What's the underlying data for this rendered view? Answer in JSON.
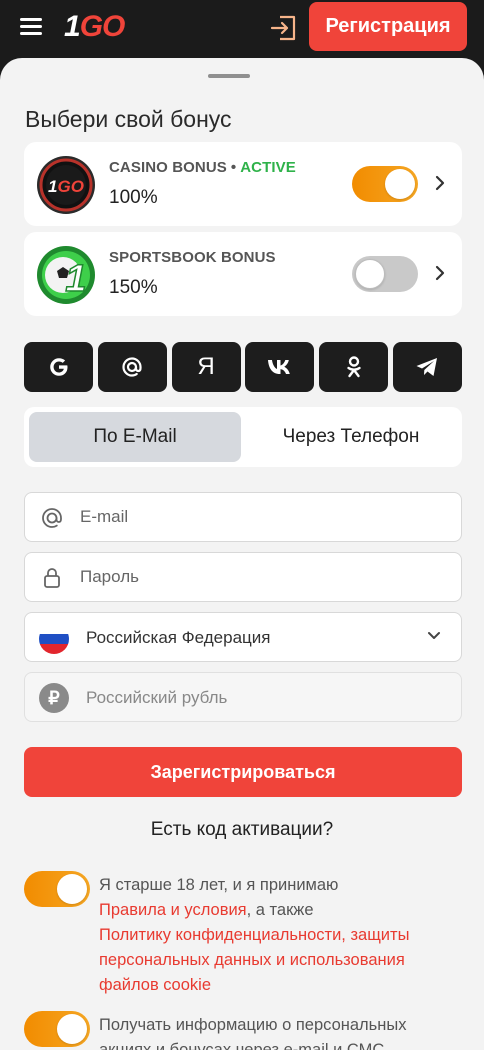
{
  "header": {
    "logo_one": "1",
    "logo_go": "GO",
    "register_label": "Регистрация"
  },
  "bonus": {
    "title": "Выбери свой бонус",
    "cards": [
      {
        "name": "CASINO BONUS",
        "status": "ACTIVE",
        "percent": "100%",
        "enabled": true,
        "badge_text": "1GO"
      },
      {
        "name": "SPORTSBOOK BONUS",
        "percent": "150%",
        "enabled": false,
        "badge_text": "1"
      }
    ]
  },
  "socials": [
    {
      "name": "google",
      "glyph": "G"
    },
    {
      "name": "email",
      "glyph": "@"
    },
    {
      "name": "yandex",
      "glyph": "Я"
    },
    {
      "name": "vk",
      "glyph": "vk"
    },
    {
      "name": "odnoklassniki",
      "glyph": "ok"
    },
    {
      "name": "telegram",
      "glyph": "tg"
    }
  ],
  "tabs": {
    "email": "По E-Mail",
    "phone": "Через Телефон",
    "active": "email"
  },
  "form": {
    "email_placeholder": "E-mail",
    "password_placeholder": "Пароль",
    "country": "Российская Федерация",
    "currency": "Российский рубль",
    "submit_label": "Зарегистрироваться",
    "promo_label": "Есть код активации?"
  },
  "consents": {
    "age": {
      "enabled": true,
      "text_before": "Я старше 18 лет, и я принимаю",
      "terms_link": "Правила и условия",
      "middle": ", а также",
      "privacy_link": "Политику конфиденциальности, защиты персональных данных и использования файлов cookie"
    },
    "marketing": {
      "enabled": true,
      "text": "Получать информацию о персональных акциях и бонусах через e-mail и СМС"
    }
  },
  "colors": {
    "accent": "#f0443a",
    "active_status": "#2fb24a",
    "toggle_on": "#f28c00",
    "dark": "#1b1b1b"
  }
}
